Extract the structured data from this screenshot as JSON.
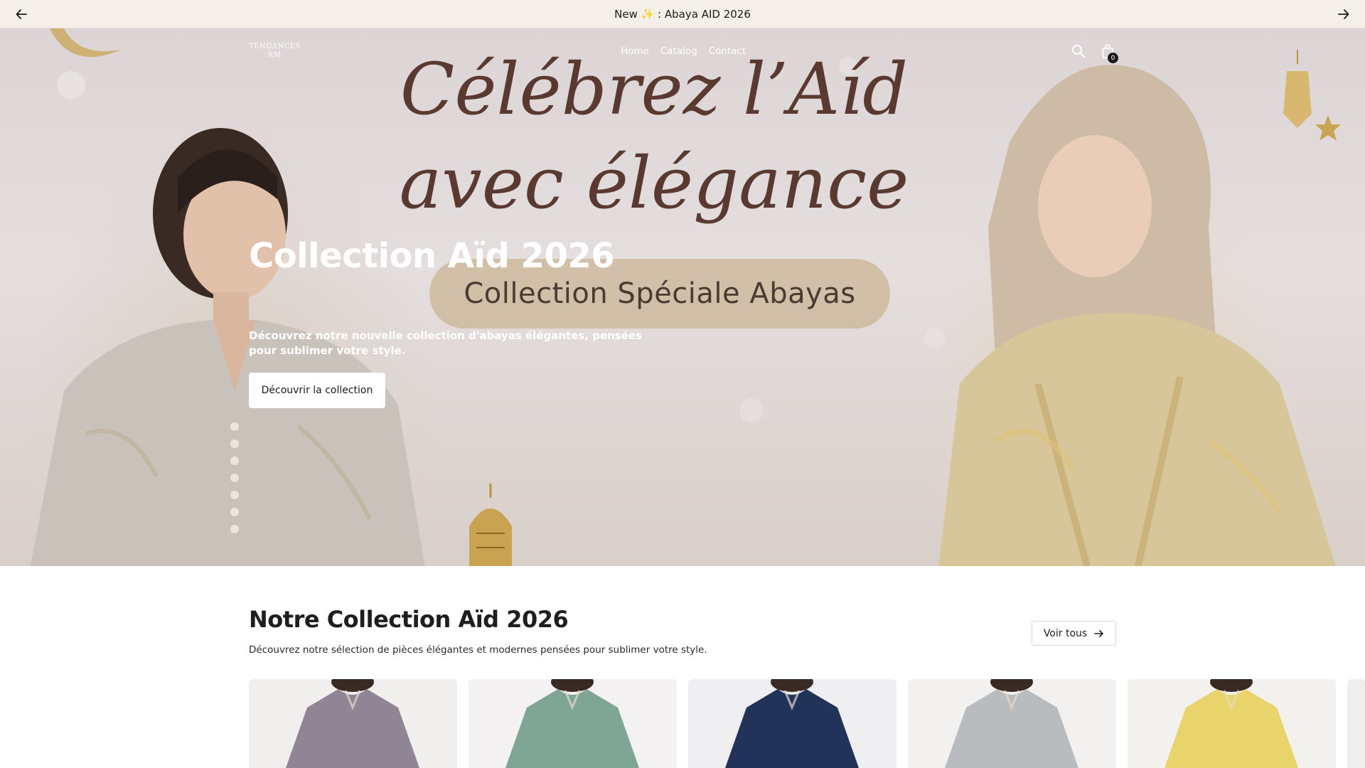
{
  "announcement": {
    "message": "New ✨ : Abaya AID 2026",
    "prev_icon": "arrow-left-icon",
    "next_icon": "arrow-right-icon"
  },
  "header": {
    "logo_line1": "TENDANCES",
    "logo_line2": "RM",
    "nav": [
      "Home",
      "Catalog",
      "Contact"
    ],
    "search_icon": "search-icon",
    "cart_icon": "shopping-bag-icon",
    "cart_count": "0"
  },
  "hero": {
    "script_line1": "Célébrez l’Aíd",
    "script_line2": "avec élégance",
    "pill_text": "Collection Spéciale Abayas",
    "title": "Collection Aïd 2026",
    "description": "Découvrez notre nouvelle collection d'abayas élégantes, pensées pour sublimer votre style.",
    "button_label": "Découvrir la collection"
  },
  "collection": {
    "title": "Notre Collection Aïd 2026",
    "description": "Découvrez notre sélection de pièces élégantes et modernes pensées pour sublimer votre style.",
    "view_all_label": "Voir tous",
    "view_all_icon": "arrow-right-icon",
    "products": [
      {
        "color": "#8f8594",
        "bg": "#f1eeee"
      },
      {
        "color": "#7fa595",
        "bg": "#f3f1f1"
      },
      {
        "color": "#22335a",
        "bg": "#efeef0"
      },
      {
        "color": "#b9bcbf",
        "bg": "#f2f1f0"
      },
      {
        "color": "#e9d36b",
        "bg": "#f3f1ee"
      }
    ]
  },
  "colors": {
    "announcement_bg": "#f4efe8",
    "script_text": "#5a3a30",
    "pill_bg": "#cbb496"
  }
}
